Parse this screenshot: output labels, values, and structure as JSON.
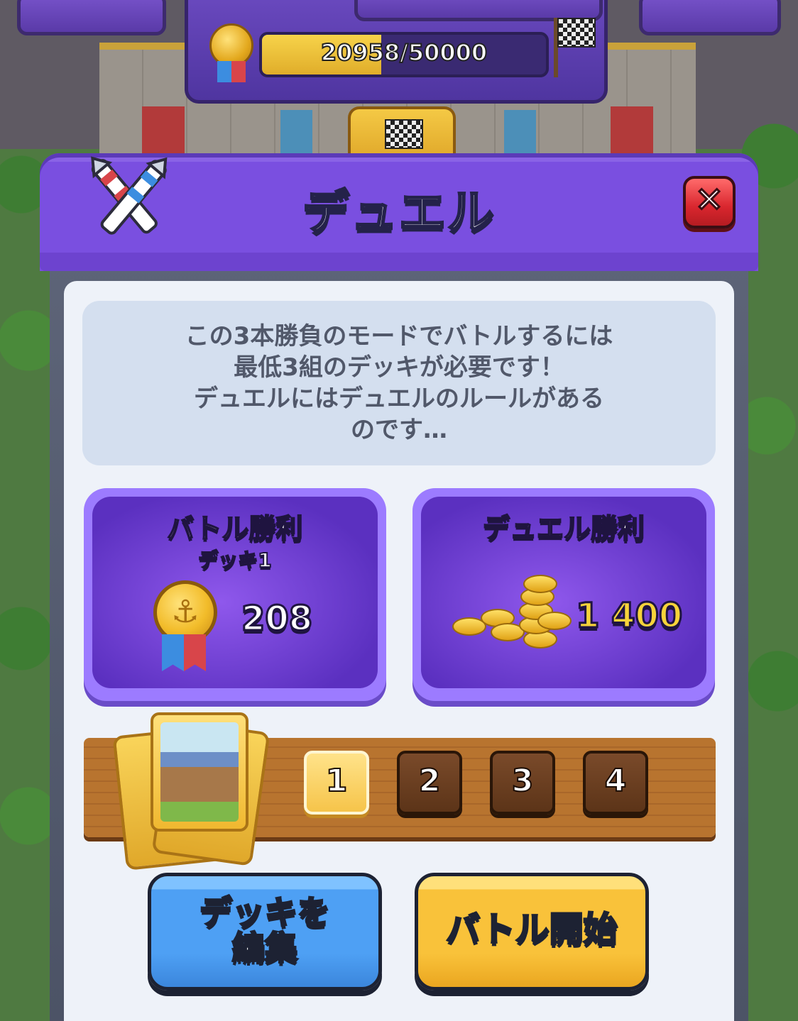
{
  "top_bar": {
    "progress_text": "20958/50000",
    "progress_fraction": 0.419
  },
  "dialog": {
    "title": "デュエル",
    "info_text": "この3本勝負のモードでバトルするには\n最低3組のデッキが必要です！\nデュエルにはデュエルのルールがある\nのです…"
  },
  "rewards": {
    "battle": {
      "title": "バトル勝利",
      "subtitle": "デッキ1",
      "amount": "208",
      "icon": "medal-icon"
    },
    "duel": {
      "title": "デュエル勝利",
      "amount": "1 400",
      "icon": "gold-coins-icon"
    }
  },
  "deck_selector": {
    "slots": [
      "1",
      "2",
      "3",
      "4"
    ],
    "active_slot": 1
  },
  "buttons": {
    "edit_deck": "デッキを\n編集",
    "battle_start": "バトル開始"
  },
  "colors": {
    "accent_purple": "#7a4fe0",
    "blue_button": "#4ea0f4",
    "gold_button": "#f9c23a",
    "close_red": "#d9262e"
  }
}
